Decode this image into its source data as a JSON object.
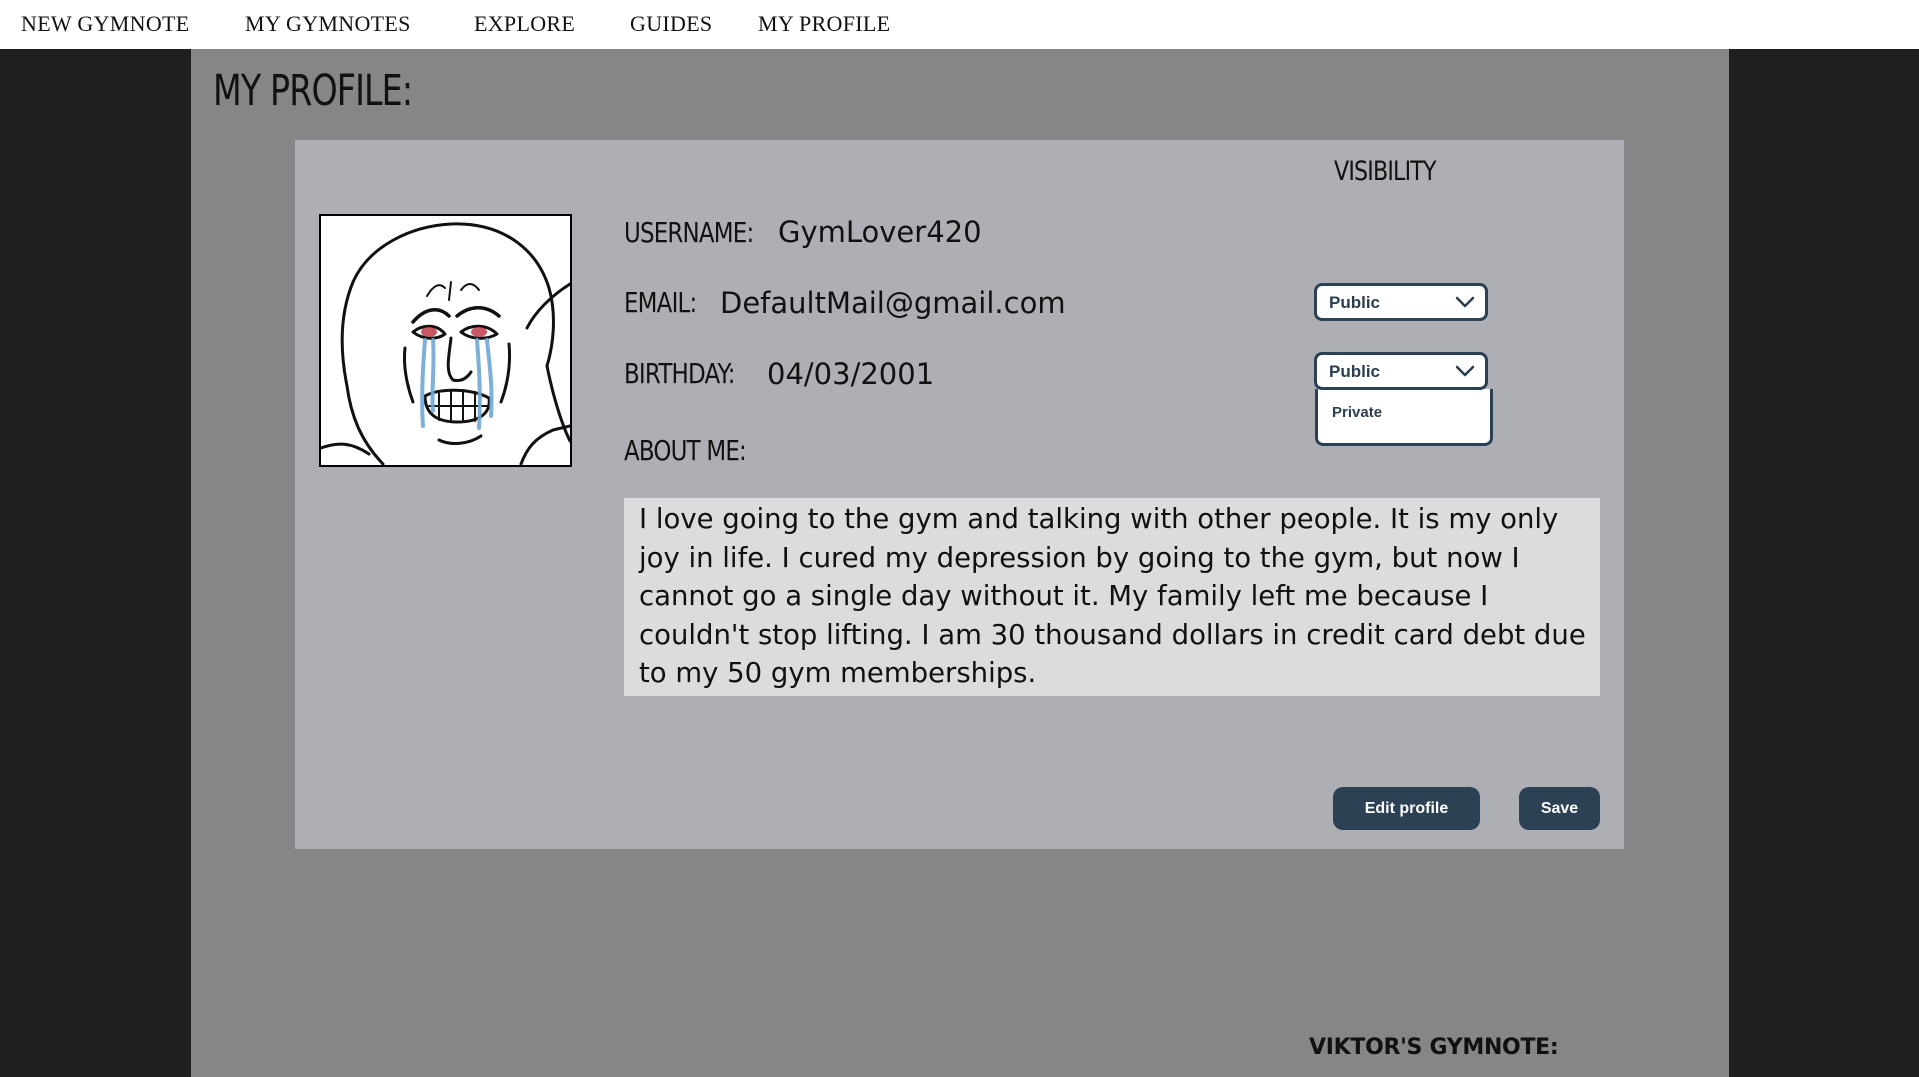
{
  "nav": {
    "items": [
      "NEW GYMNOTE",
      "MY GYMNOTES",
      "EXPLORE",
      "GUIDES",
      "MY PROFILE"
    ]
  },
  "page": {
    "title": "MY PROFILE:"
  },
  "profile": {
    "visibility_header": "VISIBILITY",
    "username_label": "USERNAME:",
    "username": "GymLover420",
    "email_label": "EMAIL:",
    "email": "DefaultMail@gmail.com",
    "email_visibility": "Public",
    "birthday_label": "BIRTHDAY:",
    "birthday": "04/03/2001",
    "birthday_visibility": "Public",
    "visibility_options": [
      "Private"
    ],
    "about_label": "ABOUT ME:",
    "about_text": "I love going to the gym and talking with other people. It is my only joy in life. I cured my depression by going to the gym, but now I cannot go a single day without it. My family left me because I couldn't stop lifting. I am 30 thousand dollars in credit card debt due to my 50 gym memberships.",
    "avatar_icon": "crying-wojak-avatar"
  },
  "actions": {
    "edit_label": "Edit profile",
    "save_label": "Save"
  },
  "footer": {
    "heading": "VIKTOR'S GYMNOTE:"
  },
  "colors": {
    "page_background": "#1f1f1f",
    "column_background": "#868686",
    "card_background": "#aeafb4",
    "about_background": "#dcdcdc",
    "button_background": "#2c4154",
    "button_text": "#ffffff"
  }
}
